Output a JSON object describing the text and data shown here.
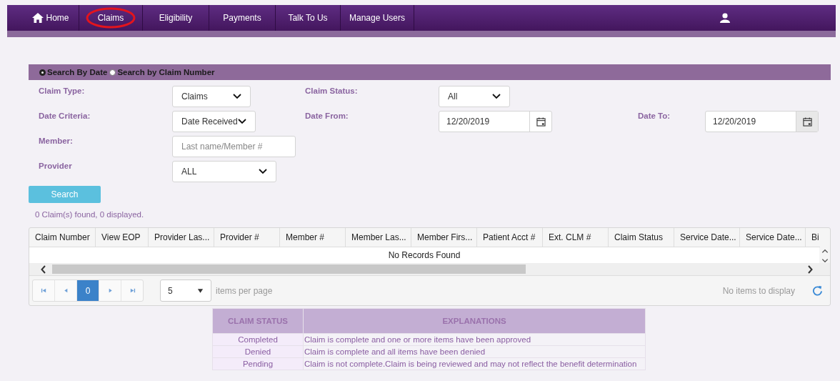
{
  "nav": {
    "items": [
      {
        "label": "Home",
        "kind": "home",
        "circled": false
      },
      {
        "label": "Claims",
        "kind": "text",
        "circled": true
      },
      {
        "label": "Eligibility",
        "kind": "text",
        "circled": false
      },
      {
        "label": "Payments",
        "kind": "text",
        "circled": false
      },
      {
        "label": "Talk To Us",
        "kind": "text",
        "circled": false
      },
      {
        "label": "Manage Users",
        "kind": "text",
        "circled": false
      }
    ]
  },
  "search_mode": [
    {
      "label": "Search By Date",
      "selected": true
    },
    {
      "label": "Search by Claim Number",
      "selected": false
    }
  ],
  "form_rows": [
    [
      {
        "label": "Claim Type:",
        "kind": "select",
        "value": "Claims"
      },
      {
        "label": "Claim Status:",
        "kind": "select",
        "value": "All"
      }
    ],
    [
      {
        "label": "Date Criteria:",
        "kind": "select",
        "value": "Date Received"
      },
      {
        "label": "Date From:",
        "kind": "date",
        "value": "12/20/2019"
      },
      {
        "label": "Date To:",
        "kind": "date",
        "value": "12/20/2019"
      }
    ],
    [
      {
        "label": "Member:",
        "kind": "input",
        "placeholder": "Last name/Member #"
      }
    ],
    [
      {
        "label": "Provider",
        "kind": "select",
        "value": "ALL"
      }
    ]
  ],
  "search_button": "Search",
  "summary": "0 Claim(s) found, 0 displayed.",
  "table": {
    "columns": [
      "Claim Number",
      "View EOP",
      "Provider Las...",
      "Provider #",
      "Member #",
      "Member Las...",
      "Member Firs...",
      "Patient Acct #",
      "Ext. CLM #",
      "Claim Status",
      "Service Date...",
      "Service Date...",
      "Bi"
    ],
    "empty_message": "No Records Found"
  },
  "pager": {
    "page": "0",
    "page_size": "5",
    "items_per_page": "items per page",
    "status": "No items to display"
  },
  "legend": {
    "columns": [
      "CLAIM STATUS",
      "EXPLANATIONS"
    ],
    "rows": [
      {
        "status": "Completed",
        "explanation": "Claim is complete and one or more items have been approved"
      },
      {
        "status": "Denied",
        "explanation": "Claim is complete and all items have been denied"
      },
      {
        "status": "Pending",
        "explanation": "Claim is not complete.Claim is being reviewed and may not reflect the benefit determination"
      }
    ]
  }
}
